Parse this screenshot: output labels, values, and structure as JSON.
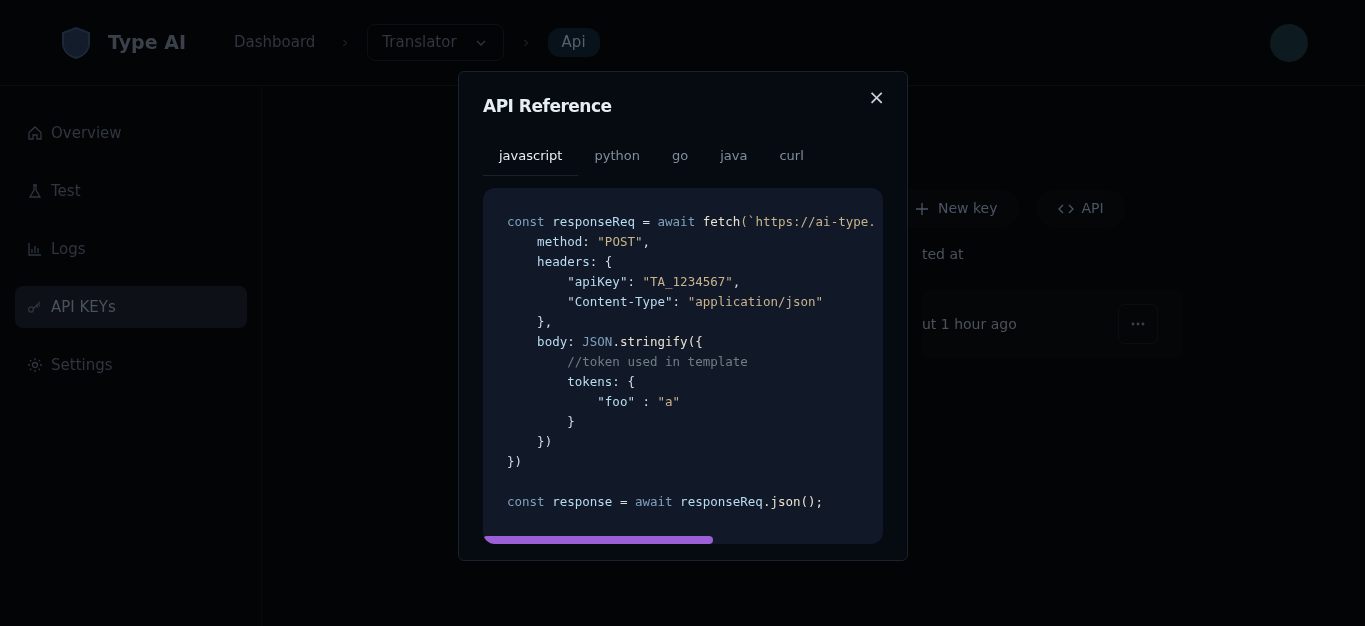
{
  "header": {
    "brand": "Type AI",
    "breadcrumbs": [
      {
        "label": "Dashboard",
        "kind": "link"
      },
      {
        "label": "Translator",
        "kind": "dropdown"
      },
      {
        "label": "Api",
        "kind": "current"
      }
    ]
  },
  "sidebar": {
    "items": [
      {
        "label": "Overview",
        "selected": false
      },
      {
        "label": "Test",
        "selected": false
      },
      {
        "label": "Logs",
        "selected": false
      },
      {
        "label": "API KEYs",
        "selected": true
      },
      {
        "label": "Settings",
        "selected": false
      }
    ]
  },
  "keys_panel": {
    "buttons": [
      {
        "label": "New key"
      },
      {
        "label": "API"
      }
    ],
    "column_header": "ted at",
    "rows": [
      {
        "created": "ut 1 hour ago"
      }
    ]
  },
  "modal": {
    "title": "API Reference",
    "close": "×",
    "tabs": [
      {
        "label": "javascript",
        "selected": true
      },
      {
        "label": "python",
        "selected": false
      },
      {
        "label": "go",
        "selected": false
      },
      {
        "label": "java",
        "selected": false
      },
      {
        "label": "curl",
        "selected": false
      }
    ],
    "code_lines": [
      {
        "tokens": [
          {
            "t": "const ",
            "kind": "kw"
          },
          {
            "t": "responseReq",
            "kind": "var"
          },
          {
            "t": " = ",
            "kind": "punct"
          },
          {
            "t": "await ",
            "kind": "kw"
          },
          {
            "t": "fetch",
            "kind": "fn"
          },
          {
            "t": "(`https://ai-type.",
            "kind": "str"
          }
        ]
      },
      {
        "tokens": [
          {
            "t": "    method",
            "kind": "var"
          },
          {
            "t": ": ",
            "kind": "punct"
          },
          {
            "t": "\"POST\"",
            "kind": "str"
          },
          {
            "t": ",",
            "kind": "punct"
          }
        ]
      },
      {
        "tokens": [
          {
            "t": "    headers",
            "kind": "var"
          },
          {
            "t": ": {",
            "kind": "punct"
          }
        ]
      },
      {
        "tokens": [
          {
            "t": "        \"apiKey\"",
            "kind": "var"
          },
          {
            "t": ": ",
            "kind": "punct"
          },
          {
            "t": "\"TA_1234567\"",
            "kind": "str"
          },
          {
            "t": ",",
            "kind": "punct"
          }
        ]
      },
      {
        "tokens": [
          {
            "t": "        \"Content-Type\"",
            "kind": "var"
          },
          {
            "t": ": ",
            "kind": "punct"
          },
          {
            "t": "\"application/json\"",
            "kind": "str"
          }
        ]
      },
      {
        "tokens": [
          {
            "t": "    },",
            "kind": "punct"
          }
        ]
      },
      {
        "tokens": [
          {
            "t": "    body",
            "kind": "var"
          },
          {
            "t": ": ",
            "kind": "punct"
          },
          {
            "t": "JSON",
            "kind": "kw"
          },
          {
            "t": ".stringify({",
            "kind": "fn"
          }
        ]
      },
      {
        "tokens": [
          {
            "t": "        //token used in template",
            "kind": "comment"
          }
        ]
      },
      {
        "tokens": [
          {
            "t": "        tokens",
            "kind": "var"
          },
          {
            "t": ": {",
            "kind": "punct"
          }
        ]
      },
      {
        "tokens": [
          {
            "t": "            \"foo\"",
            "kind": "var"
          },
          {
            "t": " : ",
            "kind": "punct"
          },
          {
            "t": "\"a\"",
            "kind": "str"
          }
        ]
      },
      {
        "tokens": [
          {
            "t": "        }",
            "kind": "punct"
          }
        ]
      },
      {
        "tokens": [
          {
            "t": "    })",
            "kind": "punct"
          }
        ]
      },
      {
        "tokens": [
          {
            "t": "})",
            "kind": "punct"
          }
        ]
      },
      {
        "spaced": true,
        "tokens": [
          {
            "t": "const ",
            "kind": "kw"
          },
          {
            "t": "response",
            "kind": "var"
          },
          {
            "t": " = ",
            "kind": "punct"
          },
          {
            "t": "await ",
            "kind": "kw"
          },
          {
            "t": "responseReq",
            "kind": "var"
          },
          {
            "t": ".json();",
            "kind": "fn"
          }
        ]
      }
    ]
  }
}
